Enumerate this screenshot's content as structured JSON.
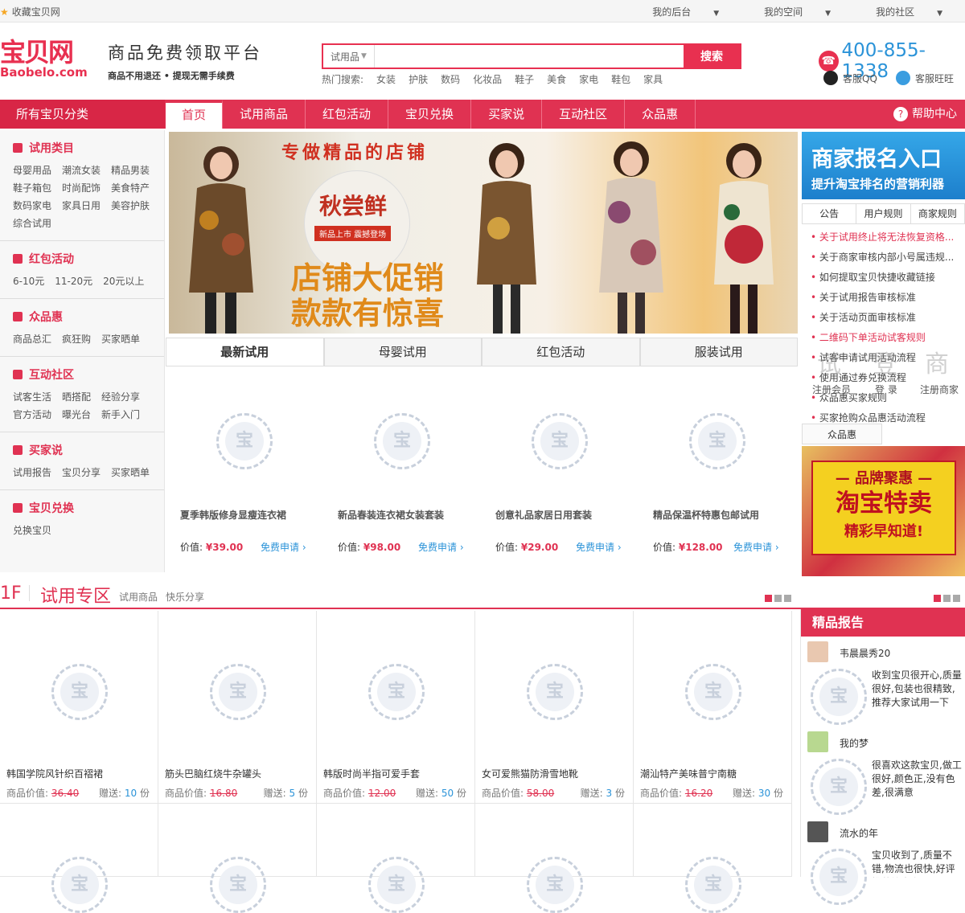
{
  "topbar": {
    "favorite": "收藏宝贝网",
    "links": [
      "我的后台",
      "我的空间",
      "我的社区"
    ]
  },
  "header": {
    "logo_cn": "宝贝网",
    "logo_en": "Baobelo.com",
    "slogan": "商品免费领取平台",
    "slogan_sub": "商品不用退还 • 提现无需手续费",
    "search": {
      "category": "试用品",
      "placeholder": "",
      "button": "搜索"
    },
    "hot_label": "热门搜索:",
    "hot": [
      "女装",
      "护肤",
      "数码",
      "化妆品",
      "鞋子",
      "美食",
      "家电",
      "鞋包",
      "家具"
    ],
    "phone": "400-855-1338",
    "qq": "客服QQ",
    "wangwang": "客服旺旺"
  },
  "nav": {
    "all": "所有宝贝分类",
    "items": [
      "首页",
      "试用商品",
      "红包活动",
      "宝贝兑换",
      "买家说",
      "互动社区",
      "众品惠"
    ],
    "help": "帮助中心"
  },
  "sidebar": [
    {
      "title": "试用类目",
      "links": [
        "母婴用品",
        "潮流女装",
        "精品男装",
        "鞋子箱包",
        "时尚配饰",
        "美食特产",
        "数码家电",
        "家具日用",
        "美容护肤",
        "综合试用"
      ]
    },
    {
      "title": "红包活动",
      "links": [
        "6-10元",
        "11-20元",
        "20元以上"
      ]
    },
    {
      "title": "众品惠",
      "links": [
        "商品总汇",
        "疯狂购",
        "买家晒单"
      ]
    },
    {
      "title": "互动社区",
      "links": [
        "试客生活",
        "晒搭配",
        "经验分享",
        "官方活动",
        "曝光台",
        "新手入门"
      ]
    },
    {
      "title": "买家说",
      "links": [
        "试用报告",
        "宝贝分享",
        "买家晒单"
      ]
    },
    {
      "title": "宝贝兑换",
      "links": [
        "兑换宝贝"
      ]
    }
  ],
  "banner": {
    "headline": "专做精品的店铺",
    "circle_title": "秋尝鲜",
    "circle_sub": "新品上市 震撼登场",
    "promo1": "店铺大促销",
    "promo2": "款款有惊喜"
  },
  "right": {
    "merchant_title": "商家报名入口",
    "merchant_sub": "提升淘宝排名的营销利器",
    "tabs": [
      "公告",
      "用户规则",
      "商家规则"
    ],
    "notices": [
      "关于试用终止将无法恢复资格...",
      "关于商家审核内部小号属违规...",
      "如何提取宝贝快捷收藏链接",
      "关于试用报告审核标准",
      "关于活动页面审核标准",
      "二维码下单活动试客规则",
      "试客申请试用活动流程",
      "使用通过券兑换流程",
      "众品惠买家规则",
      "买家抢购众品惠活动流程"
    ],
    "ghost": {
      "reg_member": "注册会员",
      "login": "登 录",
      "reg_merchant": "注册商家",
      "g1": "试",
      "g2": "登",
      "g3": "商"
    },
    "zph": "众品惠",
    "promo": {
      "l1": "— 品牌聚惠 —",
      "l2": "淘宝特卖",
      "l3": "精彩早知道!"
    }
  },
  "product_tabs": [
    "最新试用",
    "母婴试用",
    "红包活动",
    "服装试用"
  ],
  "latest": [
    {
      "title": "夏季韩版修身显瘦连衣裙",
      "price_label": "价值:",
      "price": "¥39.00",
      "apply": "免费申请"
    },
    {
      "title": "新品春装连衣裙女装套装",
      "price_label": "价值:",
      "price": "¥98.00",
      "apply": "免费申请"
    },
    {
      "title": "创意礼品家居日用套装",
      "price_label": "价值:",
      "price": "¥29.00",
      "apply": "免费申请"
    },
    {
      "title": "精品保温杯特惠包邮试用",
      "price_label": "价值:",
      "price": "¥128.00",
      "apply": "免费申请"
    }
  ],
  "loader_char": "宝",
  "floor": {
    "num": "1F",
    "title": "试用专区",
    "subs": [
      "试用商品",
      "快乐分享"
    ]
  },
  "floor_items": [
    {
      "name": "韩国学院风针织百褶裙",
      "price_label": "商品价值:",
      "price": "36.40",
      "gift_label": "赠送:",
      "qty": "10",
      "unit": "份"
    },
    {
      "name": "筋头巴脑红烧牛杂罐头",
      "price_label": "商品价值:",
      "price": "16.80",
      "gift_label": "赠送:",
      "qty": "5",
      "unit": "份"
    },
    {
      "name": "韩版时尚半指可爱手套",
      "price_label": "商品价值:",
      "price": "12.00",
      "gift_label": "赠送:",
      "qty": "50",
      "unit": "份"
    },
    {
      "name": "女可爱熊猫防滑雪地靴",
      "price_label": "商品价值:",
      "price": "58.00",
      "gift_label": "赠送:",
      "qty": "3",
      "unit": "份"
    },
    {
      "name": "潮汕特产美味普宁南糖",
      "price_label": "商品价值:",
      "price": "16.20",
      "gift_label": "赠送:",
      "qty": "30",
      "unit": "份"
    }
  ],
  "reports": {
    "title": "精品报告",
    "items": [
      {
        "name": "韦晨晨秀20",
        "text": "收到宝贝很开心,质量很好,包装也很精致,推荐大家试用一下"
      },
      {
        "name": "我的梦",
        "text": "很喜欢这款宝贝,做工很好,颜色正,没有色差,很满意"
      },
      {
        "name": "流水的年",
        "text": "宝贝收到了,质量不错,物流也很快,好评推荐给大家"
      }
    ]
  },
  "colors": {
    "brand": "#e03252",
    "link": "#2b93d8"
  }
}
